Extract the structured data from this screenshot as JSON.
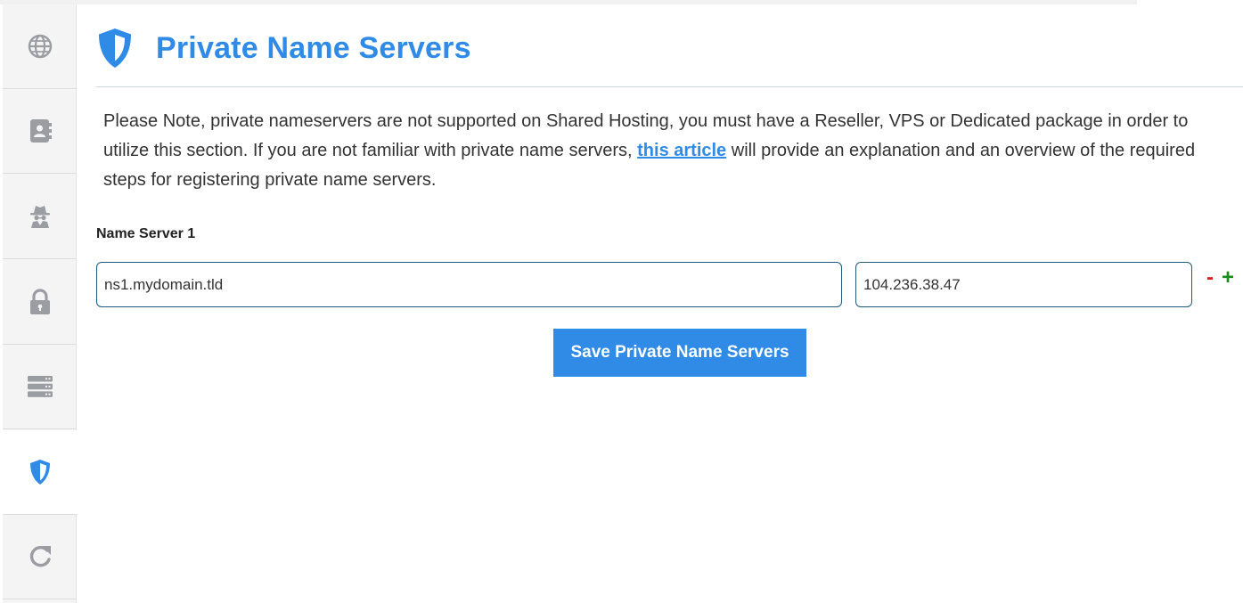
{
  "sidebar": {
    "items": [
      {
        "name": "globe-icon",
        "active": false
      },
      {
        "name": "contact-book-icon",
        "active": false
      },
      {
        "name": "privacy-spy-icon",
        "active": false
      },
      {
        "name": "lock-icon",
        "active": false
      },
      {
        "name": "server-stack-icon",
        "active": false
      },
      {
        "name": "shield-icon",
        "active": true
      },
      {
        "name": "renew-icon",
        "active": false
      }
    ],
    "icon_color": "#9a9ea3",
    "active_icon_color": "#2f8be6"
  },
  "header": {
    "icon": "shield-icon",
    "title": "Private Name Servers"
  },
  "note": {
    "before_link": "Please Note, private nameservers are not supported on Shared Hosting, you must have a Reseller, VPS or Dedicated package in order to utilize this section. If you are not familiar with private name servers, ",
    "link_text": "this article",
    "after_link": " will provide an explanation and an overview of the required steps for registering private name servers."
  },
  "nameservers": [
    {
      "label": "Name Server 1",
      "hostname": "ns1.mydomain.tld",
      "ip": "104.236.38.47"
    }
  ],
  "controls": {
    "remove": "-",
    "add": "+"
  },
  "save_button": "Save Private Name Servers",
  "colors": {
    "accent": "#2f8be6",
    "remove": "#e02020",
    "add": "#1a8a1a"
  }
}
